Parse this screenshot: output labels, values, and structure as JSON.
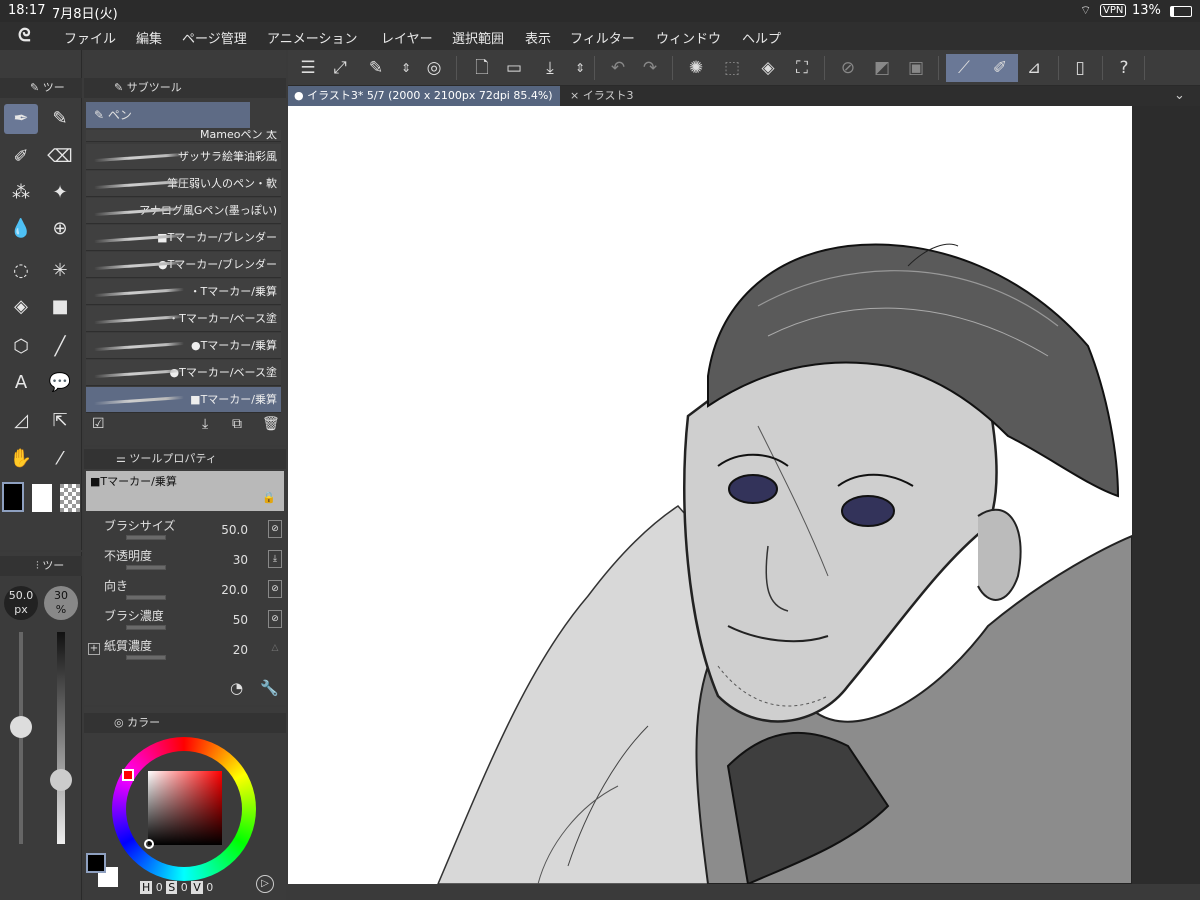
{
  "status": {
    "time": "18:17",
    "date": "7月8日(火)",
    "vpn": "VPN",
    "battery": "13%"
  },
  "menu": [
    "ファイル",
    "編集",
    "ページ管理",
    "アニメーション",
    "レイヤー",
    "選択範囲",
    "表示",
    "フィルター",
    "ウィンドウ",
    "ヘルプ"
  ],
  "tabs": [
    {
      "label": "● イラスト3* 5/7 (2000 x 2100px 72dpi 85.4%)",
      "active": true
    },
    {
      "label": "× イラスト3",
      "active": false
    }
  ],
  "panels": {
    "tool_tab": "ツー",
    "subtool_tab": "サブツール",
    "property_tab": "ツールプロパティ",
    "color_tab": "カラー",
    "slider_tab": "ツー"
  },
  "subtool": {
    "group": "ペン",
    "items": [
      {
        "label": "Mameoペン 太",
        "selected": false
      },
      {
        "label": "ザッサラ絵筆油彩風",
        "selected": false
      },
      {
        "label": "筆圧弱い人のペン・軟",
        "selected": false
      },
      {
        "label": "アナログ風Gペン(墨っぽい)",
        "selected": false
      },
      {
        "label": "■Tマーカー/ブレンダー",
        "selected": false
      },
      {
        "label": "●Tマーカー/ブレンダー",
        "selected": false
      },
      {
        "label": "・Tマーカー/乗算",
        "selected": false
      },
      {
        "label": "・Tマーカー/ベース塗",
        "selected": false
      },
      {
        "label": "●Tマーカー/乗算",
        "selected": false
      },
      {
        "label": "●Tマーカー/ベース塗",
        "selected": false
      },
      {
        "label": "■Tマーカー/乗算",
        "selected": true
      }
    ]
  },
  "property": {
    "tool_name": "■Tマーカー/乗算",
    "rows": [
      {
        "label": "ブラシサイズ",
        "value": "50.0"
      },
      {
        "label": "不透明度",
        "value": "30"
      },
      {
        "label": "向き",
        "value": "20.0"
      },
      {
        "label": "ブラシ濃度",
        "value": "50"
      },
      {
        "label": "紙質濃度",
        "value": "20"
      }
    ]
  },
  "slider": {
    "size": "50.0",
    "size_unit": "px",
    "opacity": "30",
    "opacity_unit": "%",
    "size_level": 0.55,
    "opacity_level": 0.3
  },
  "color": {
    "h_label": "H",
    "h": "0",
    "s_label": "S",
    "s": "0",
    "v_label": "V",
    "v": "0",
    "main": "#000000",
    "sub": "#ffffff"
  },
  "accent": "#6a7896"
}
